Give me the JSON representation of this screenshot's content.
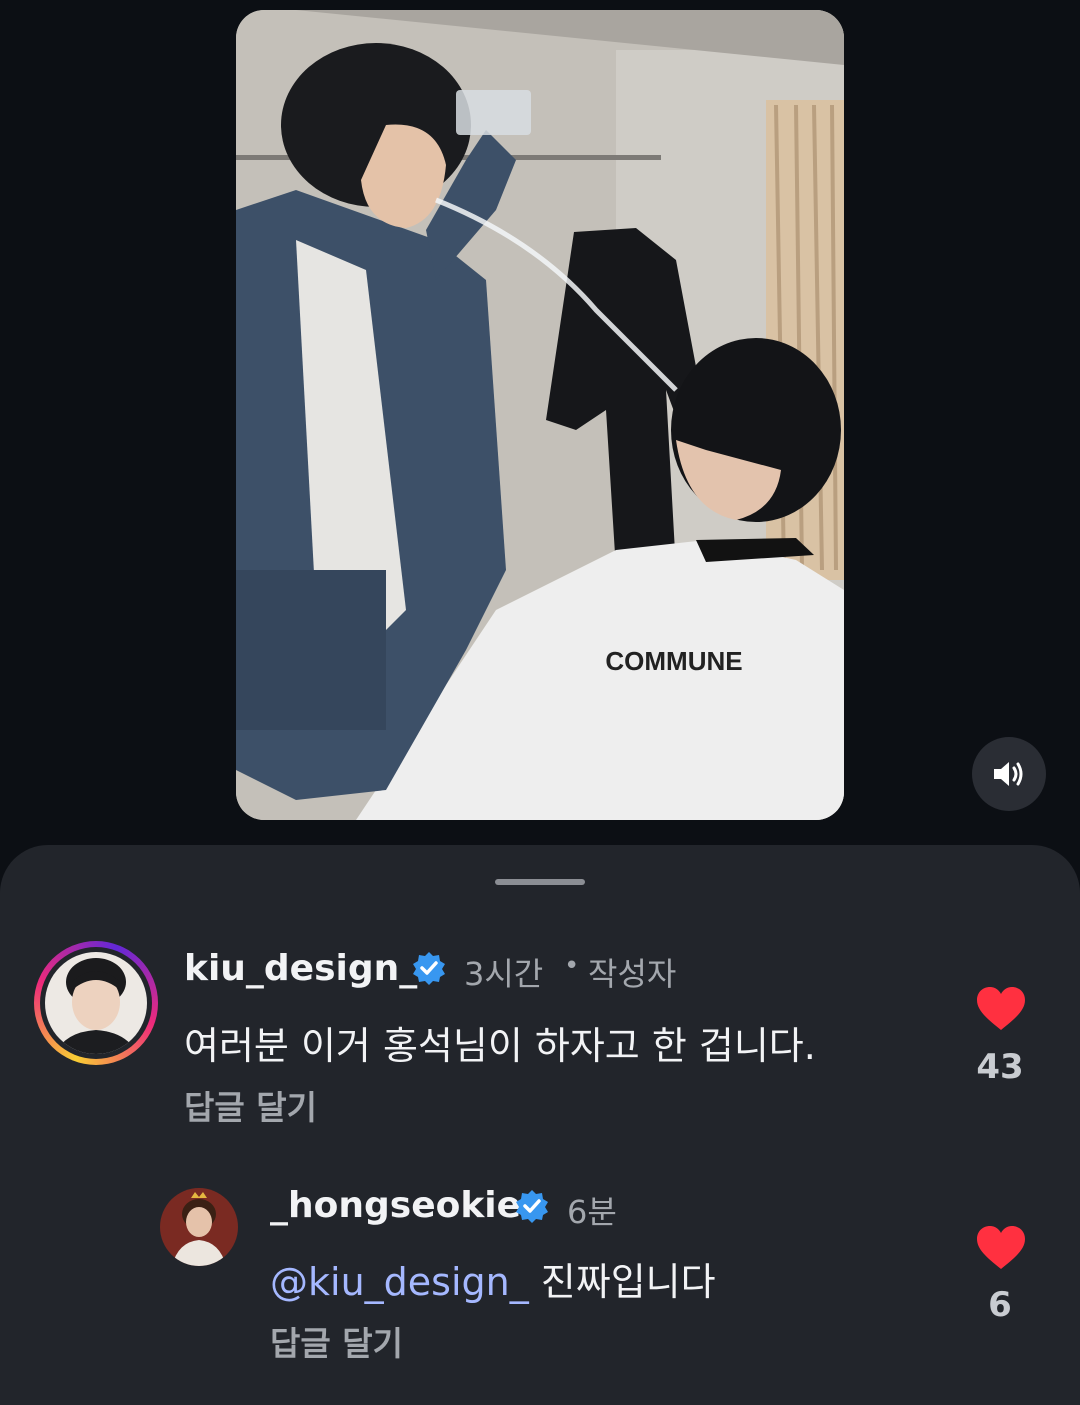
{
  "video": {
    "brand_text": "COMMUNE"
  },
  "comments": [
    {
      "username": "kiu_design_",
      "verified": true,
      "time": "3시간",
      "separator": "•",
      "author_badge": "작성자",
      "text": "여러분 이거 홍석님이 하자고 한 겁니다.",
      "reply_label": "답글 달기",
      "like_count": "43"
    },
    {
      "username": "_hongseokie",
      "verified": true,
      "time": "6분",
      "mention": "@kiu_design_",
      "text": " 진짜입니다",
      "reply_label": "답글 달기",
      "like_count": "6"
    }
  ],
  "colors": {
    "background": "#0c0f14",
    "sheet": "#22252b",
    "verified": "#3897f0",
    "like": "#ff3040",
    "mention": "#a5b8ff"
  },
  "icons": {
    "sound": "speaker-on-icon",
    "like": "heart-filled-icon",
    "verified": "verified-badge-icon"
  }
}
